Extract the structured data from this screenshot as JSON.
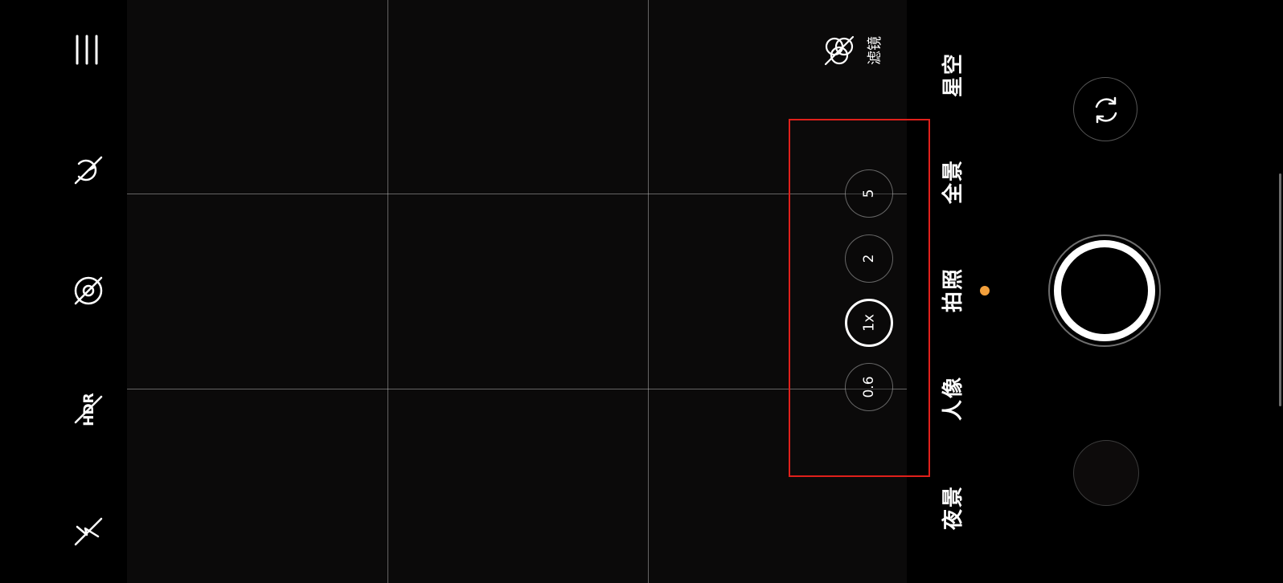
{
  "left_bar": {
    "icons": [
      "menu-icon",
      "timer-off-icon",
      "live-photo-off-icon",
      "hdr-off-icon",
      "flash-off-icon"
    ],
    "hdr_label": "HDR"
  },
  "viewfinder": {
    "filter_label": "滤镜",
    "zoom_levels": [
      "5",
      "2",
      "1x",
      "0.6"
    ],
    "active_zoom": "1x"
  },
  "modes": {
    "items": [
      "星空",
      "全景",
      "拍照",
      "人像",
      "夜景"
    ],
    "selected": "拍照"
  },
  "colors": {
    "accent": "#f3a03c",
    "highlight": "#e0201b",
    "viewfinder_bg": "#0b0a0a"
  }
}
